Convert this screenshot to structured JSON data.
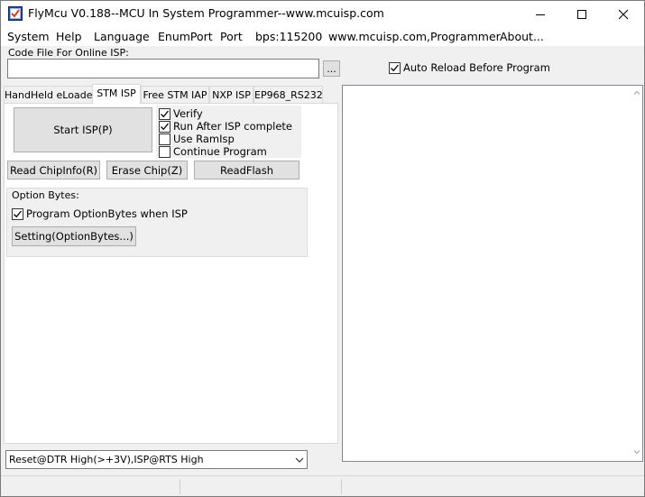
{
  "window": {
    "title": "FlyMcu V0.188--MCU In System Programmer--www.mcuisp.com",
    "controls": {
      "minimize": "minimize-icon",
      "maximize": "maximize-icon",
      "close": "close-icon"
    }
  },
  "menu": [
    {
      "label": "System"
    },
    {
      "label": "Help"
    },
    {
      "label": "Language"
    },
    {
      "label": "EnumPort"
    },
    {
      "label": "Port"
    },
    {
      "label": "bps:115200"
    },
    {
      "label": "www.mcuisp.com,Programmer"
    },
    {
      "label": "About..."
    }
  ],
  "code_file": {
    "label": "Code File For Online ISP:",
    "value": "",
    "browse_label": "..."
  },
  "auto_reload": {
    "label": "Auto Reload Before Program",
    "checked": true
  },
  "tabs": [
    {
      "label": "HandHeld eLoader",
      "active": false
    },
    {
      "label": "STM ISP",
      "active": true
    },
    {
      "label": "Free STM IAP",
      "active": false
    },
    {
      "label": "NXP ISP",
      "active": false
    },
    {
      "label": "EP968_RS232",
      "active": false
    }
  ],
  "stm_isp": {
    "start_label": "Start ISP(P)",
    "options": [
      {
        "label": "Verify",
        "checked": true
      },
      {
        "label": "Run After ISP complete",
        "checked": true
      },
      {
        "label": "Use RamIsp",
        "checked": false
      },
      {
        "label": "Continue Program",
        "checked": false
      }
    ],
    "read_chipinfo_label": "Read ChipInfo(R)",
    "erase_chip_label": "Erase Chip(Z)",
    "readflash_label": "ReadFlash",
    "option_bytes": {
      "title": "Option Bytes:",
      "program_label": "Program OptionBytes when ISP",
      "program_checked": true,
      "setting_label": "Setting(OptionBytes...)"
    }
  },
  "reset_mode": {
    "selected": "Reset@DTR High(>+3V),ISP@RTS High"
  },
  "log": {
    "text": ""
  },
  "colors": {
    "face": "#f0f0f0",
    "button": "#e1e1e1",
    "border": "#adadad",
    "check": "#000000"
  }
}
